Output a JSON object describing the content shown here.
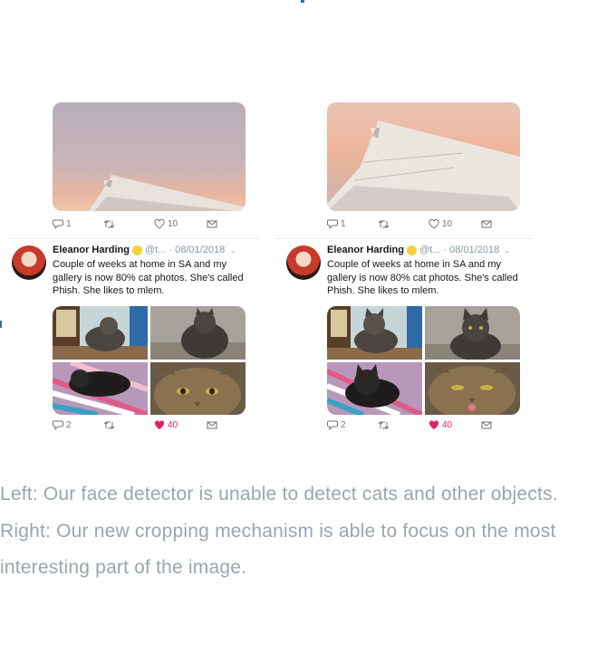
{
  "panels": [
    {
      "id": "left",
      "banner_actions": {
        "reply_count": "1",
        "like_count": "10"
      },
      "tweet": {
        "name": "Eleanor Harding",
        "handle_date": "@t... · 08/01/2018",
        "text": "Couple of weeks at home in SA and my gallery is now 80% cat photos. She's called Phish. She likes to mlem.",
        "reply_count": "2",
        "like_count": "40"
      }
    },
    {
      "id": "right",
      "banner_actions": {
        "reply_count": "1",
        "like_count": "10"
      },
      "tweet": {
        "name": "Eleanor Harding",
        "handle_date": "@t... · 08/01/2018",
        "text": "Couple of weeks at home in SA and my gallery is now 80% cat photos. She's called Phish. She likes to mlem.",
        "reply_count": "2",
        "like_count": "40"
      }
    }
  ],
  "caption": "Left: Our face detector is unable to detect cats and other objects. Right: Our new cropping mechanism is able to focus on the most interesting part of the image.",
  "colors": {
    "like_active": "#e0245e",
    "icon_gray": "#6b7680",
    "caption_gray": "#9aa5ae"
  }
}
